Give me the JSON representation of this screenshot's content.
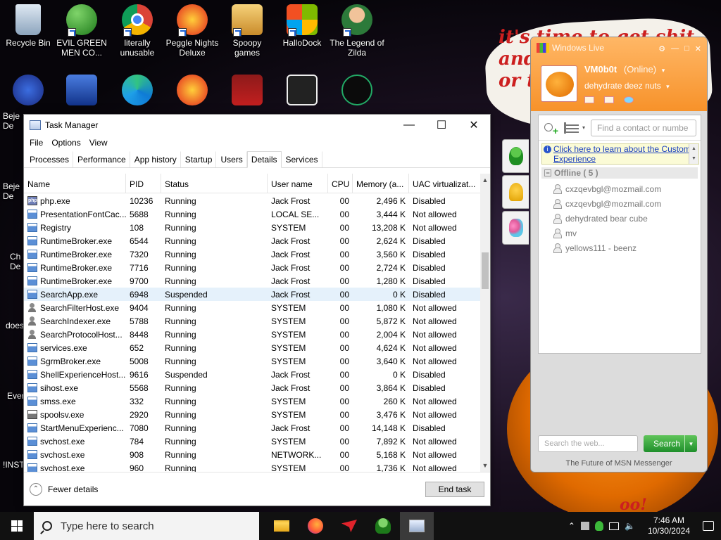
{
  "desktop": {
    "sign_text": "it's time to get shit\nand\nor t",
    "icons": [
      {
        "label": "Recycle Bin"
      },
      {
        "label": "EVIL GREEN MEN CO..."
      },
      {
        "label": "literally unusable"
      },
      {
        "label": "Peggle Nights Deluxe"
      },
      {
        "label": "Spoopy games"
      },
      {
        "label": "HalloDock"
      },
      {
        "label": "The Legend of Zilda"
      }
    ],
    "left_fragments": [
      "Beje",
      "De",
      "Beje",
      "De",
      "Ch",
      "De",
      "does",
      "Ever",
      "!INST"
    ],
    "bottom_fragment": "oo!"
  },
  "task_manager": {
    "title": "Task Manager",
    "menu": [
      "File",
      "Options",
      "View"
    ],
    "tabs": [
      "Processes",
      "Performance",
      "App history",
      "Startup",
      "Users",
      "Details",
      "Services"
    ],
    "active_tab": "Details",
    "columns": [
      "Name",
      "PID",
      "Status",
      "User name",
      "CPU",
      "Memory (a...",
      "UAC virtualizat..."
    ],
    "rows": [
      {
        "icon": "php",
        "name": "php.exe",
        "pid": "10236",
        "status": "Running",
        "user": "Jack Frost",
        "cpu": "00",
        "mem": "2,496 K",
        "uac": "Disabled"
      },
      {
        "icon": "app",
        "name": "PresentationFontCac...",
        "pid": "5688",
        "status": "Running",
        "user": "LOCAL SE...",
        "cpu": "00",
        "mem": "3,444 K",
        "uac": "Not allowed"
      },
      {
        "icon": "app",
        "name": "Registry",
        "pid": "108",
        "status": "Running",
        "user": "SYSTEM",
        "cpu": "00",
        "mem": "13,208 K",
        "uac": "Not allowed"
      },
      {
        "icon": "app",
        "name": "RuntimeBroker.exe",
        "pid": "6544",
        "status": "Running",
        "user": "Jack Frost",
        "cpu": "00",
        "mem": "2,624 K",
        "uac": "Disabled"
      },
      {
        "icon": "app",
        "name": "RuntimeBroker.exe",
        "pid": "7320",
        "status": "Running",
        "user": "Jack Frost",
        "cpu": "00",
        "mem": "3,560 K",
        "uac": "Disabled"
      },
      {
        "icon": "app",
        "name": "RuntimeBroker.exe",
        "pid": "7716",
        "status": "Running",
        "user": "Jack Frost",
        "cpu": "00",
        "mem": "2,724 K",
        "uac": "Disabled"
      },
      {
        "icon": "app",
        "name": "RuntimeBroker.exe",
        "pid": "9700",
        "status": "Running",
        "user": "Jack Frost",
        "cpu": "00",
        "mem": "1,280 K",
        "uac": "Disabled"
      },
      {
        "icon": "app",
        "name": "SearchApp.exe",
        "pid": "6948",
        "status": "Suspended",
        "user": "Jack Frost",
        "cpu": "00",
        "mem": "0 K",
        "uac": "Disabled",
        "selected": true
      },
      {
        "icon": "person",
        "name": "SearchFilterHost.exe",
        "pid": "9404",
        "status": "Running",
        "user": "SYSTEM",
        "cpu": "00",
        "mem": "1,080 K",
        "uac": "Not allowed"
      },
      {
        "icon": "person",
        "name": "SearchIndexer.exe",
        "pid": "5788",
        "status": "Running",
        "user": "SYSTEM",
        "cpu": "00",
        "mem": "5,872 K",
        "uac": "Not allowed"
      },
      {
        "icon": "person",
        "name": "SearchProtocolHost...",
        "pid": "8448",
        "status": "Running",
        "user": "SYSTEM",
        "cpu": "00",
        "mem": "2,004 K",
        "uac": "Not allowed"
      },
      {
        "icon": "app",
        "name": "services.exe",
        "pid": "652",
        "status": "Running",
        "user": "SYSTEM",
        "cpu": "00",
        "mem": "4,624 K",
        "uac": "Not allowed"
      },
      {
        "icon": "app",
        "name": "SgrmBroker.exe",
        "pid": "5008",
        "status": "Running",
        "user": "SYSTEM",
        "cpu": "00",
        "mem": "3,640 K",
        "uac": "Not allowed"
      },
      {
        "icon": "app",
        "name": "ShellExperienceHost...",
        "pid": "9616",
        "status": "Suspended",
        "user": "Jack Frost",
        "cpu": "00",
        "mem": "0 K",
        "uac": "Disabled"
      },
      {
        "icon": "app",
        "name": "sihost.exe",
        "pid": "5568",
        "status": "Running",
        "user": "Jack Frost",
        "cpu": "00",
        "mem": "3,864 K",
        "uac": "Disabled"
      },
      {
        "icon": "app",
        "name": "smss.exe",
        "pid": "332",
        "status": "Running",
        "user": "SYSTEM",
        "cpu": "00",
        "mem": "260 K",
        "uac": "Not allowed"
      },
      {
        "icon": "printer",
        "name": "spoolsv.exe",
        "pid": "2920",
        "status": "Running",
        "user": "SYSTEM",
        "cpu": "00",
        "mem": "3,476 K",
        "uac": "Not allowed"
      },
      {
        "icon": "app",
        "name": "StartMenuExperienc...",
        "pid": "7080",
        "status": "Running",
        "user": "Jack Frost",
        "cpu": "00",
        "mem": "14,148 K",
        "uac": "Disabled"
      },
      {
        "icon": "app",
        "name": "svchost.exe",
        "pid": "784",
        "status": "Running",
        "user": "SYSTEM",
        "cpu": "00",
        "mem": "7,892 K",
        "uac": "Not allowed"
      },
      {
        "icon": "app",
        "name": "svchost.exe",
        "pid": "908",
        "status": "Running",
        "user": "NETWORK...",
        "cpu": "00",
        "mem": "5,168 K",
        "uac": "Not allowed"
      },
      {
        "icon": "app",
        "name": "svchost.exe",
        "pid": "960",
        "status": "Running",
        "user": "SYSTEM",
        "cpu": "00",
        "mem": "1,736 K",
        "uac": "Not allowed"
      }
    ],
    "fewer_details": "Fewer details",
    "end_task": "End task"
  },
  "messenger": {
    "window_title": "Windows Live",
    "nickname": "VM0b0t",
    "status": "(Online)",
    "personal_message": "dehydrate deez nuts",
    "search_contact_placeholder": "Find a contact or numbe",
    "notice": "Click here to learn about the Customer Experience",
    "group": "Offline ( 5 )",
    "contacts": [
      "cxzqevbgl@mozmail.com",
      "cxzqevbgl@mozmail.com",
      "dehydrated bear cube",
      "mv",
      "yellows111 - beenz"
    ],
    "web_search_placeholder": "Search the web...",
    "search_button": "Search",
    "footer": "The Future of MSN Messenger"
  },
  "taskbar": {
    "search_placeholder": "Type here to search",
    "time": "7:46 AM",
    "date": "10/30/2024"
  }
}
